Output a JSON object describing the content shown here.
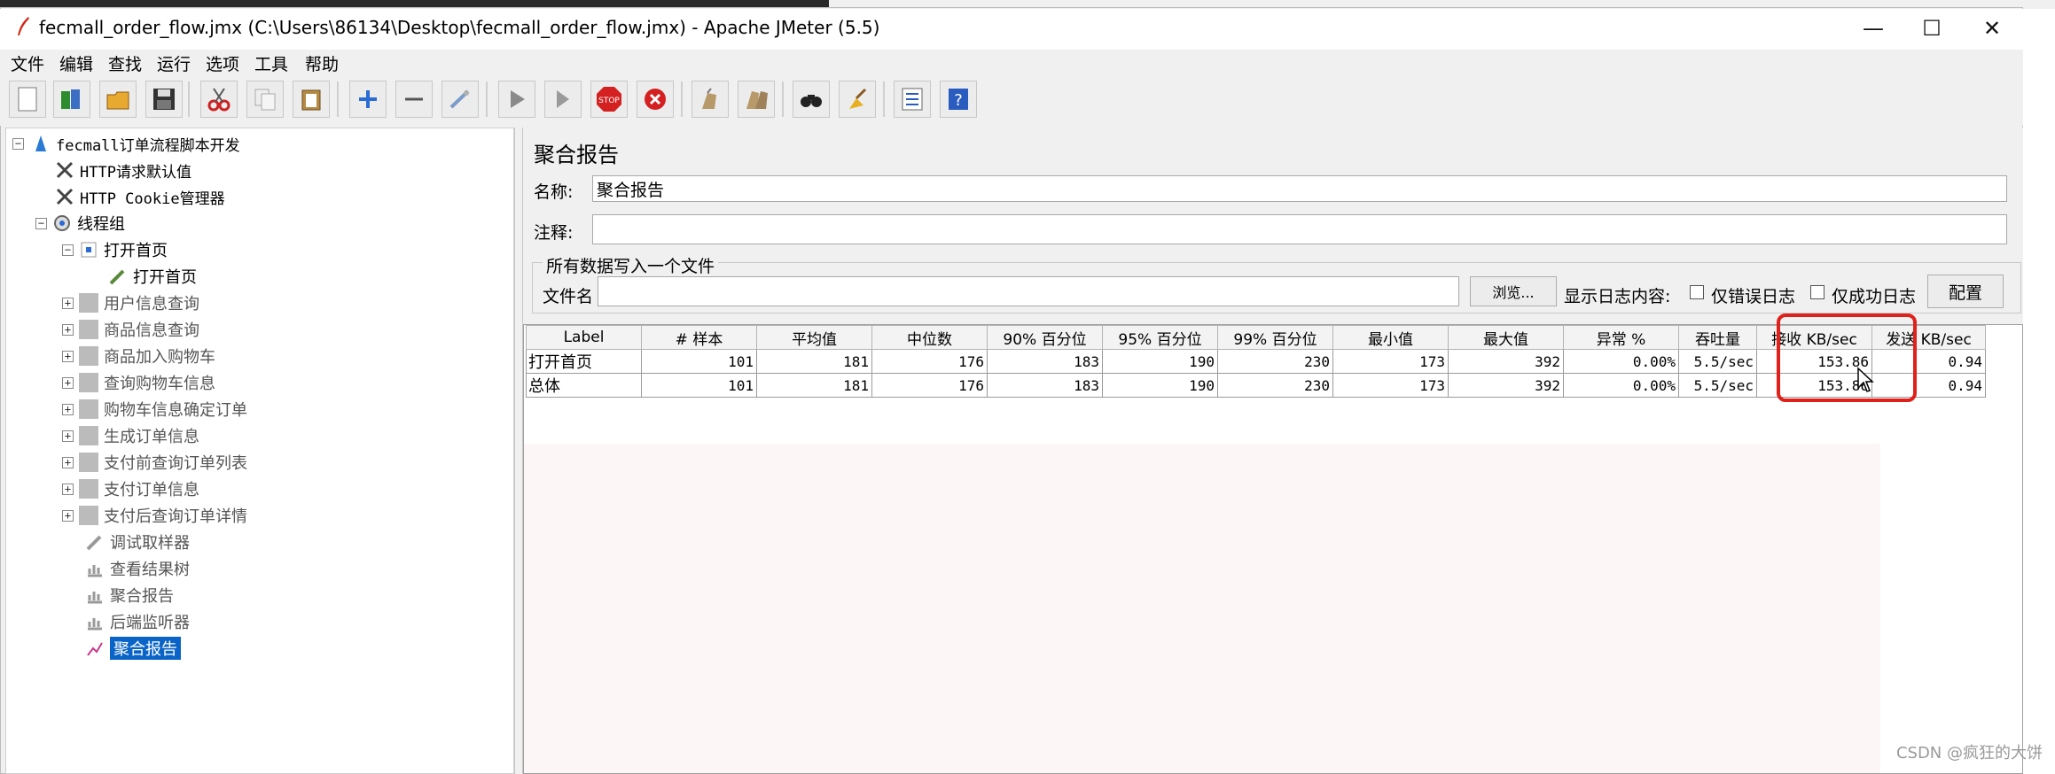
{
  "window": {
    "title": "fecmall_order_flow.jmx (C:\\Users\\86134\\Desktop\\fecmall_order_flow.jmx) - Apache JMeter (5.5)",
    "controls": {
      "minimize": "—",
      "maximize": "☐",
      "close": "✕"
    }
  },
  "menu": [
    "文件",
    "编辑",
    "查找",
    "运行",
    "选项",
    "工具",
    "帮助"
  ],
  "toolbar": [
    "new-icon",
    "templates-icon",
    "open-icon",
    "save-icon",
    "cut-icon",
    "copy-icon",
    "paste-icon",
    "expand-icon",
    "collapse-icon",
    "toggle-icon",
    "start-icon",
    "start-no-pause-icon",
    "stop-icon",
    "shutdown-icon",
    "clear-icon",
    "clear-all-icon",
    "search-icon",
    "reset-search-icon",
    "function-helper-icon",
    "help-icon"
  ],
  "tree": {
    "root": "fecmall订单流程脚本开发",
    "config_http": "HTTP请求默认值",
    "cookie": "HTTP Cookie管理器",
    "thread_group": "线程组",
    "open_home": "打开首页",
    "open_home_sampler": "打开首页",
    "items": [
      "用户信息查询",
      "商品信息查询",
      "商品加入购物车",
      "查询购物车信息",
      "购物车信息确定订单",
      "生成订单信息",
      "支付前查询订单列表",
      "支付订单信息",
      "支付后查询订单详情"
    ],
    "debug_sampler": "调试取样器",
    "view_results": "查看结果树",
    "aggregate1": "聚合报告",
    "backend": "后端监听器",
    "aggregate2": "聚合报告"
  },
  "panel": {
    "title": "聚合报告",
    "name_label": "名称:",
    "name_value": "聚合报告",
    "comment_label": "注释:",
    "comment_value": "",
    "group_title": "所有数据写入一个文件",
    "filename_label": "文件名",
    "filename_value": "",
    "browse_button": "浏览...",
    "log_label": "显示日志内容:",
    "errors_only": "仅错误日志",
    "success_only": "仅成功日志",
    "configure_button": "配置"
  },
  "table": {
    "headers": [
      "Label",
      "# 样本",
      "平均值",
      "中位数",
      "90% 百分位",
      "95% 百分位",
      "99% 百分位",
      "最小值",
      "最大值",
      "异常 %",
      "吞吐量",
      "接收 KB/sec",
      "发送 KB/sec"
    ],
    "rows": [
      [
        "打开首页",
        "101",
        "181",
        "176",
        "183",
        "190",
        "230",
        "173",
        "392",
        "0.00%",
        "5.5/sec",
        "153.86",
        "0.94"
      ],
      [
        "总体",
        "101",
        "181",
        "176",
        "183",
        "190",
        "230",
        "173",
        "392",
        "0.00%",
        "5.5/sec",
        "153.86",
        "0.94"
      ]
    ]
  },
  "watermark": "CSDN @疯狂的大饼",
  "colors": {
    "highlight": "#e0201a",
    "selection": "#0a64c8"
  }
}
